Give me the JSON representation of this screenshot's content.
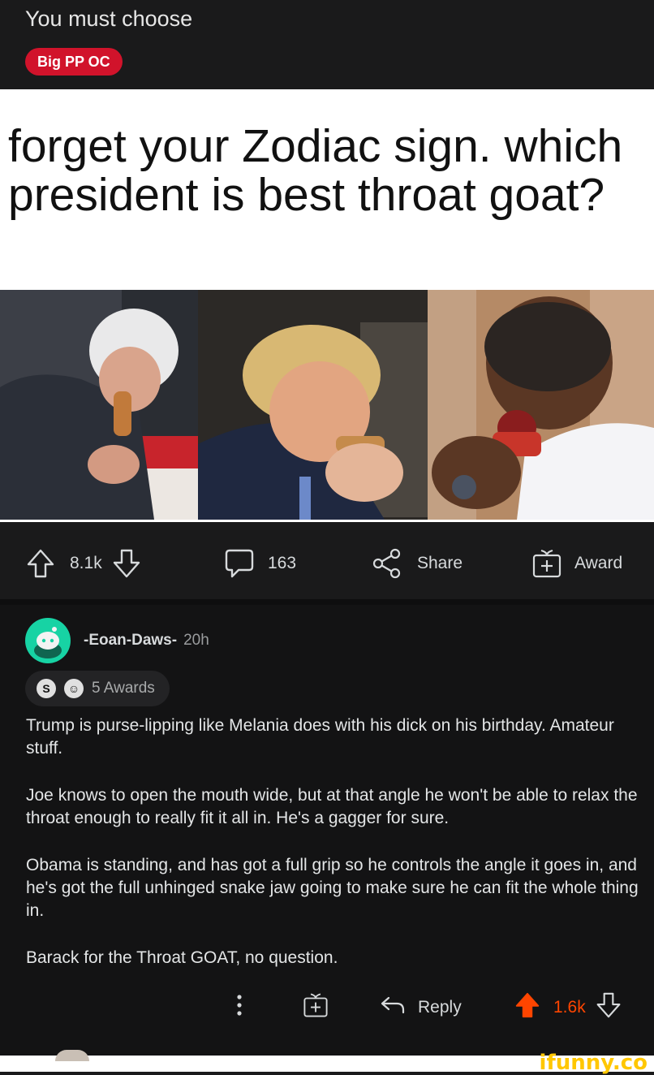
{
  "post": {
    "title": "You must choose",
    "flair": "Big PP OC",
    "meme_text": "forget your Zodiac sign. which president is best throat goat?"
  },
  "actions": {
    "upvotes": "8.1k",
    "comments": "163",
    "share": "Share",
    "award": "Award"
  },
  "comment": {
    "author": "-Eoan-Daws-",
    "age": "20h",
    "awards": "5 Awards",
    "paragraphs": [
      "Trump is purse-lipping like Melania does with his dick on his birthday. Amateur stuff.",
      "Joe knows to open the mouth wide, but at that angle he won't be able to relax the throat enough to really fit it all in. He's a gagger for sure.",
      "Obama is standing, and has got a full grip so he controls the angle it goes in, and he's got the full unhinged snake jaw going to make sure he can fit the whole thing in.",
      "Barack for the Throat GOAT, no question."
    ],
    "reply": "Reply",
    "score": "1.6k"
  },
  "watermark": "ifunny.co",
  "colors": {
    "flair_bg": "#d1132b",
    "avatar": "#17d3a4",
    "upvote_active": "#ff4500",
    "watermark": "#ffc700"
  }
}
